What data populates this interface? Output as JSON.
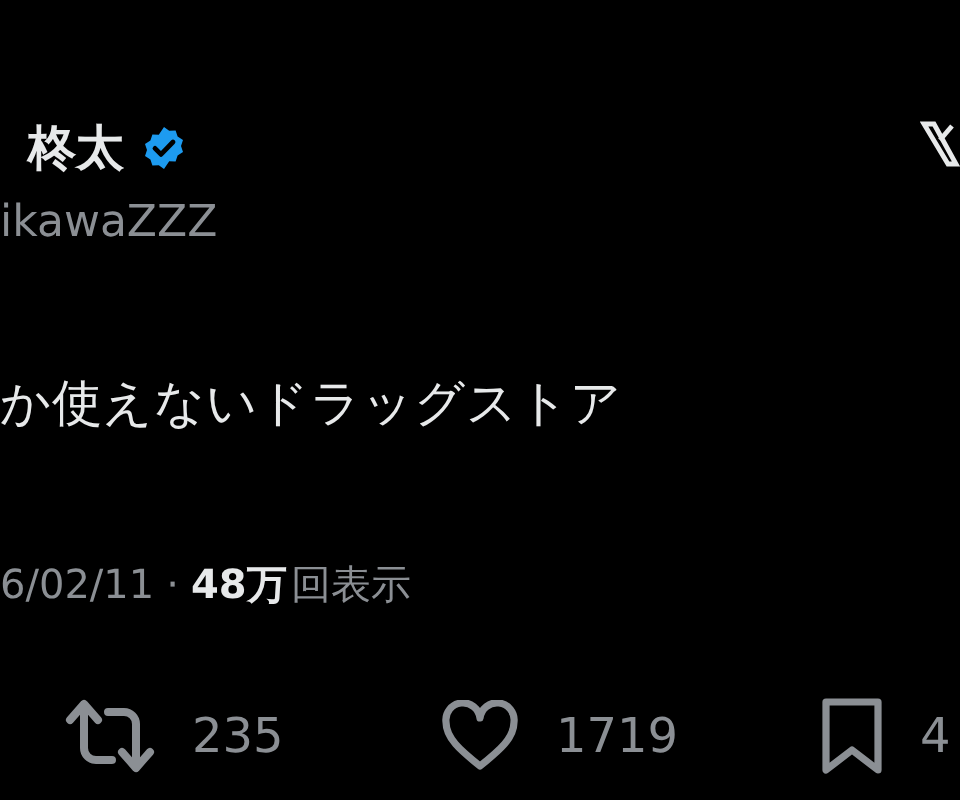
{
  "author": {
    "name": "柊太",
    "verified": true,
    "handle": "ikawaZZZ"
  },
  "post": {
    "text": "か使えないドラッグストア"
  },
  "meta": {
    "date": "6/02/11",
    "separator": "·",
    "views_count": "48万",
    "views_label": "回表示"
  },
  "actions": [
    {
      "kind": "repost",
      "count": "235"
    },
    {
      "kind": "like",
      "count": "1719"
    },
    {
      "kind": "bookmark",
      "count": "4"
    }
  ]
}
